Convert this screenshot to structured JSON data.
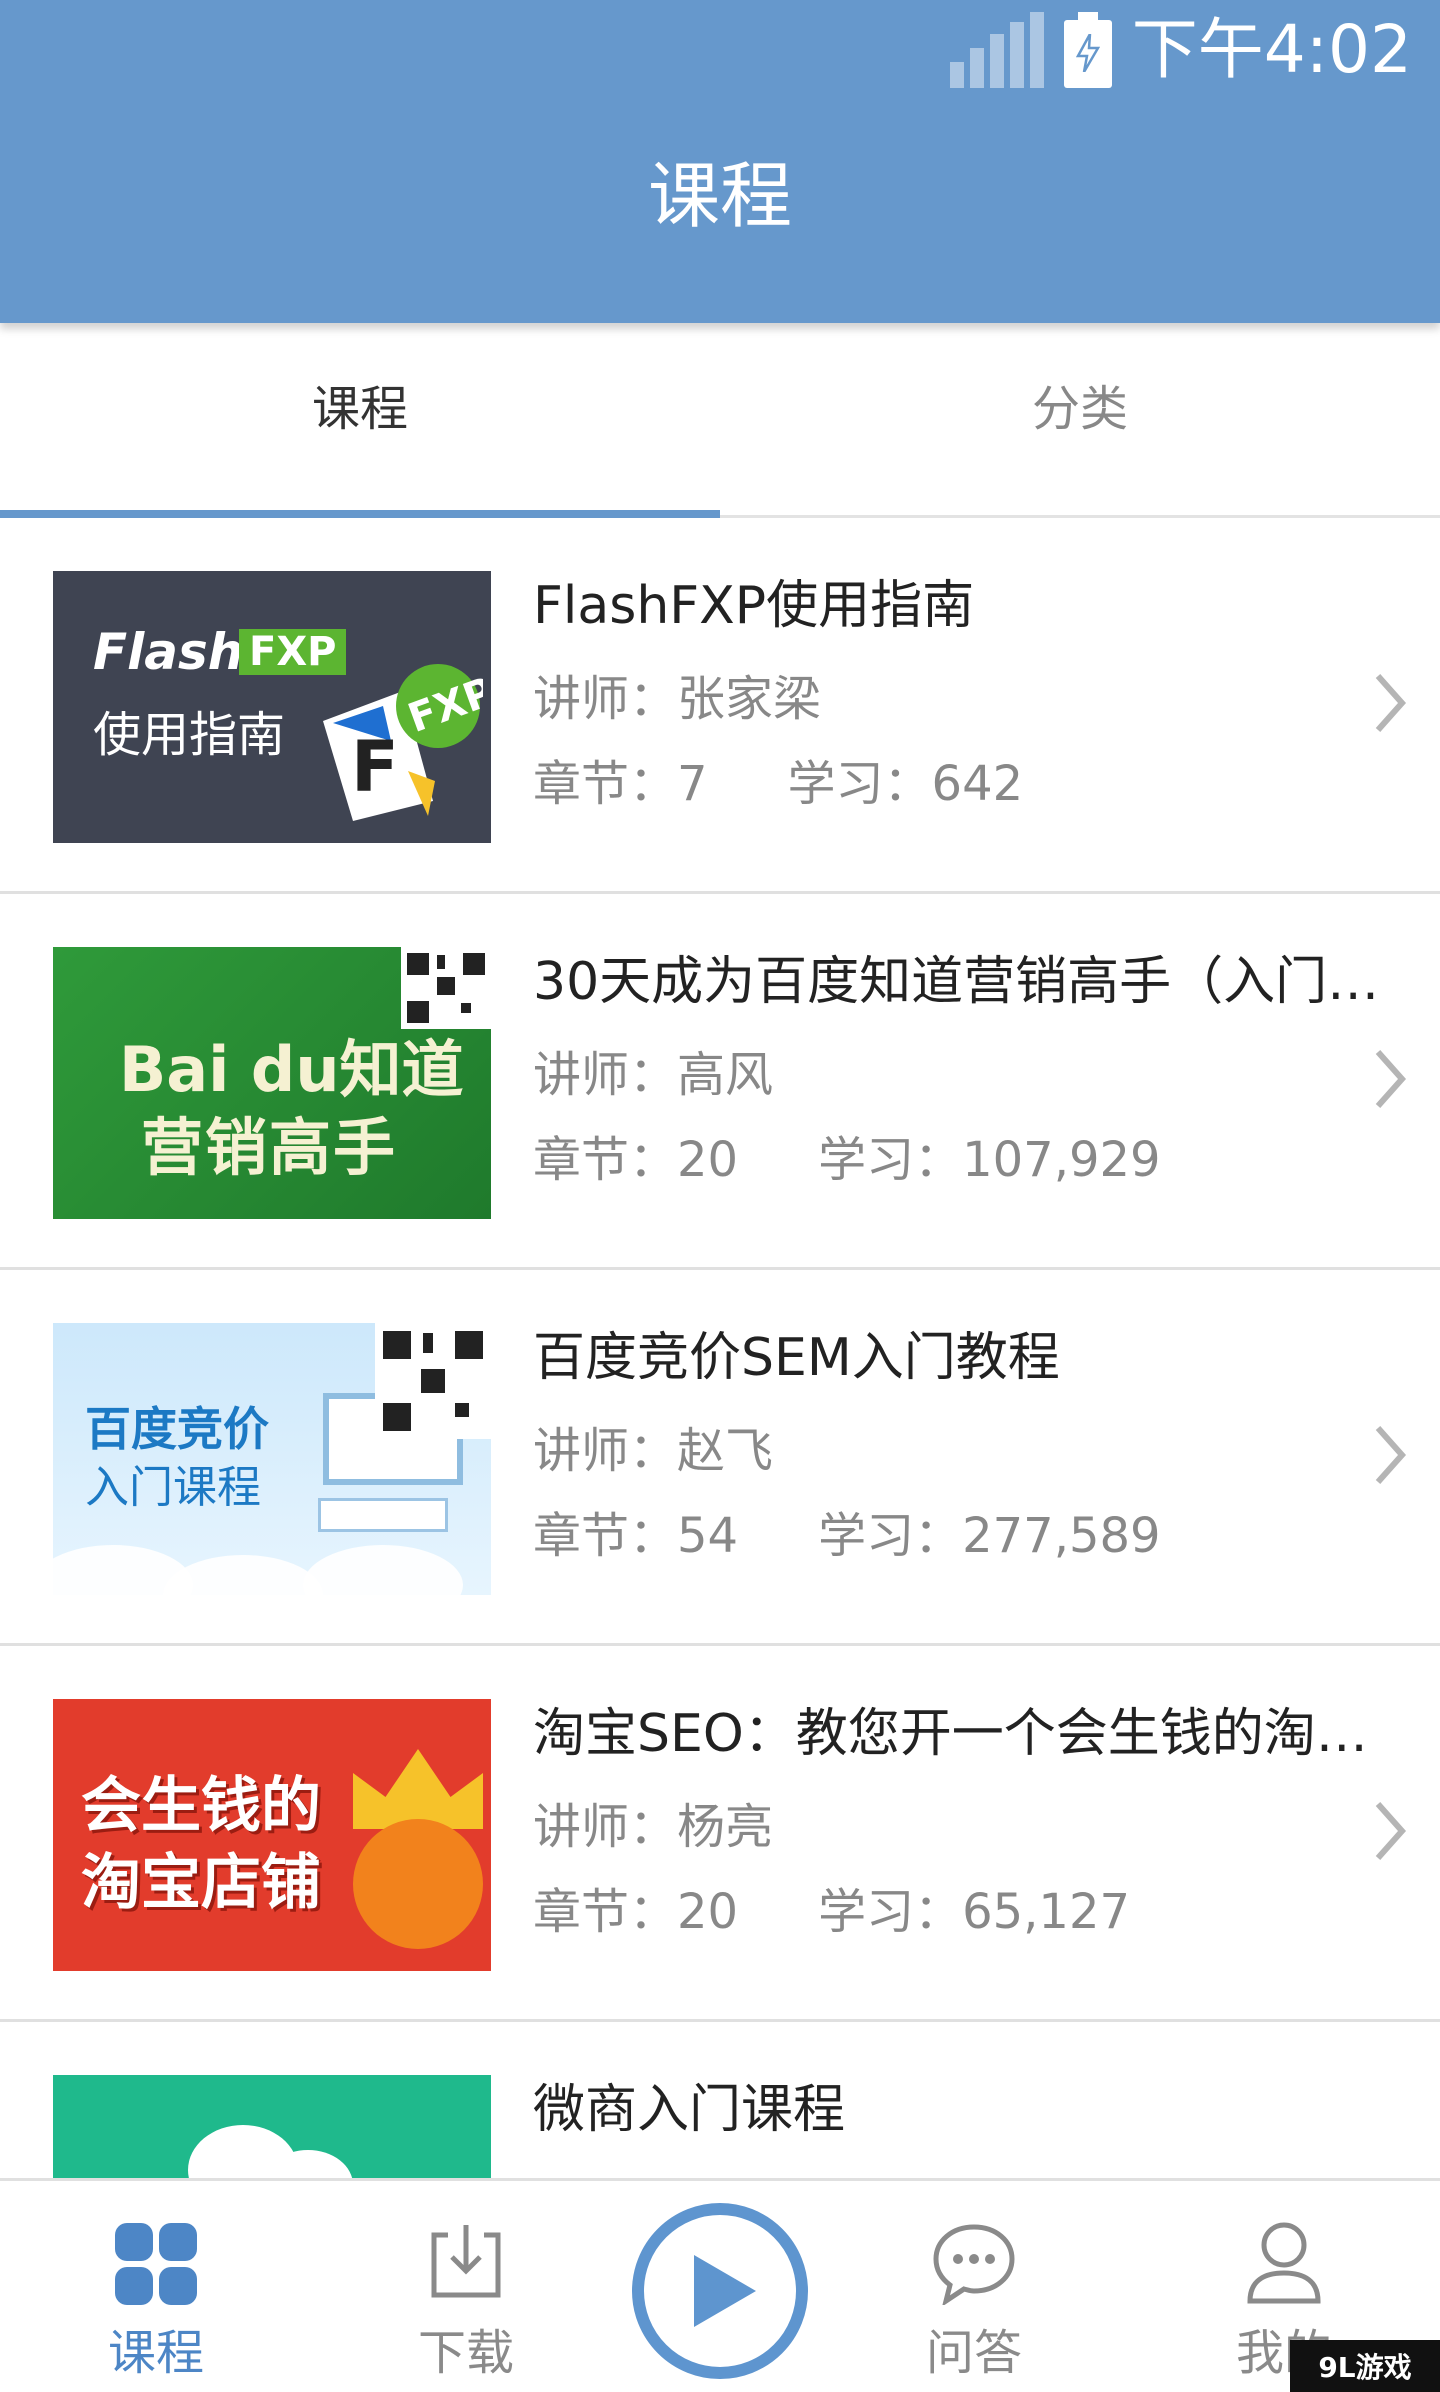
{
  "status_bar": {
    "time": "下午4:02"
  },
  "app_bar": {
    "title": "课程"
  },
  "tabs": [
    {
      "label": "课程",
      "active": true
    },
    {
      "label": "分类",
      "active": false
    }
  ],
  "courses": [
    {
      "name": "FlashFXP使用指南",
      "teacher": "讲师：张家梁",
      "chapters": "章节：7",
      "study": "学习：642",
      "thumb": {
        "line1": "Flash",
        "badge": "FXP",
        "line2": "使用指南",
        "logo_text": "FXP"
      }
    },
    {
      "name": "30天成为百度知道营销高手（入门…",
      "teacher": "讲师：高风",
      "chapters": "章节：20",
      "study": "学习：107,929",
      "thumb": {
        "line1": "Bai du知道",
        "line2": "营销高手"
      }
    },
    {
      "name": "百度竞价SEM入门教程",
      "teacher": "讲师：赵飞",
      "chapters": "章节：54",
      "study": "学习：277,589",
      "thumb": {
        "line1": "百度竞价",
        "line2": "入门课程"
      }
    },
    {
      "name": "淘宝SEO：教您开一个会生钱的淘…",
      "teacher": "讲师：杨亮",
      "chapters": "章节：20",
      "study": "学习：65,127",
      "thumb": {
        "line1": "会生钱的",
        "line2": "淘宝店铺"
      }
    },
    {
      "name": "微商入门课程",
      "teacher": "",
      "chapters": "",
      "study": ""
    }
  ],
  "bottom_nav": [
    {
      "label": "课程",
      "icon": "grid-icon",
      "active": true
    },
    {
      "label": "下载",
      "icon": "download-icon",
      "active": false
    },
    {
      "label": "",
      "icon": "play-icon",
      "active": false
    },
    {
      "label": "问答",
      "icon": "chat-icon",
      "active": false
    },
    {
      "label": "我的",
      "icon": "user-icon",
      "active": false
    }
  ],
  "watermark": "9L游戏",
  "colors": {
    "primary": "#6698cc",
    "active_nav": "#4d86c6",
    "text_muted": "#888888"
  }
}
